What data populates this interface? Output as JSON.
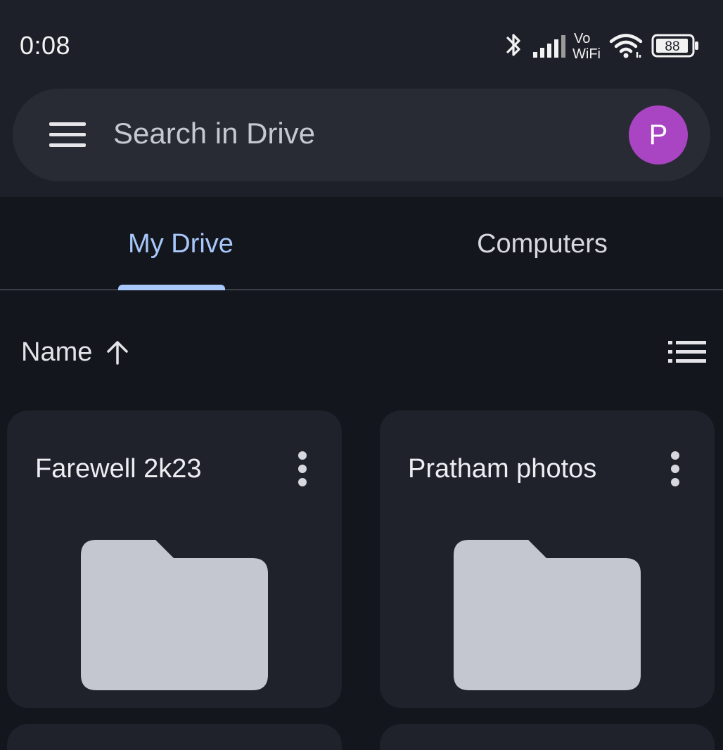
{
  "status_bar": {
    "time": "0:08",
    "battery": "88",
    "vowifi_line1": "Vo",
    "vowifi_line2": "WiFi",
    "icons": [
      "bluetooth-icon",
      "signal-icon",
      "vowifi-icon",
      "wifi-icon",
      "battery-icon"
    ]
  },
  "search": {
    "placeholder": "Search in Drive",
    "menu_icon": "hamburger-menu-icon",
    "avatar_initial": "P",
    "avatar_color": "#a944c3"
  },
  "tabs": [
    {
      "label": "My Drive",
      "selected": true
    },
    {
      "label": "Computers",
      "selected": false
    }
  ],
  "accent_color": "#a8c7fa",
  "sort": {
    "label": "Name",
    "direction_icon": "arrow-up-icon",
    "view_toggle_icon": "list-view-icon"
  },
  "folders": [
    {
      "name": "Farewell 2k23",
      "icon": "folder-icon"
    },
    {
      "name": "Pratham photos",
      "icon": "folder-icon"
    }
  ]
}
